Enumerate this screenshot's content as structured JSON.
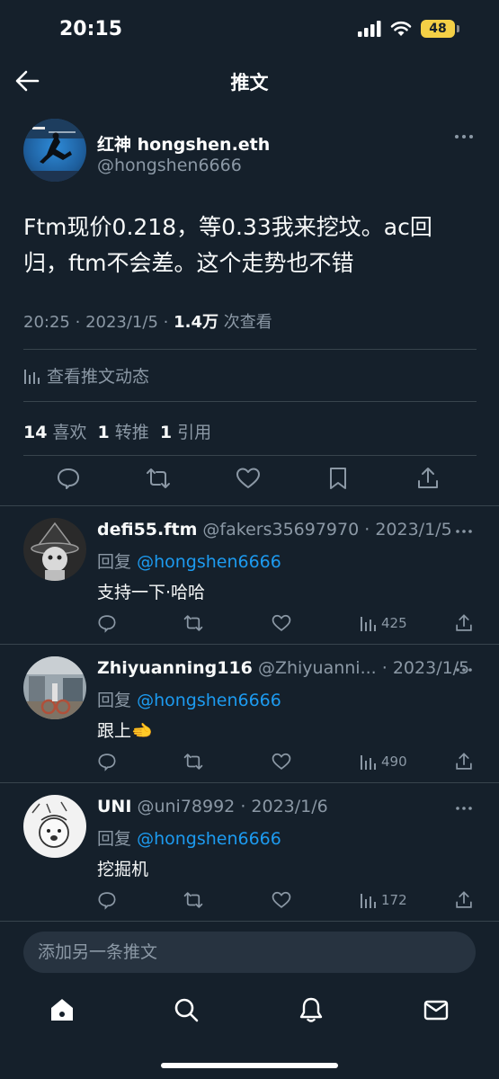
{
  "status_bar": {
    "time": "20:15",
    "battery": "48",
    "icons": [
      "cellular-signal-icon",
      "wifi-icon",
      "battery-icon"
    ]
  },
  "header": {
    "title": "推文",
    "back_icon": "arrow-left-icon"
  },
  "main_tweet": {
    "author_name": "红神 hongshen.eth",
    "author_handle": "@hongshen6666",
    "text": "Ftm现价0.218，等0.33我来挖坟。ac回归，ftm不会差。这个走势也不错",
    "time": "20:25",
    "date": "2023/1/5",
    "views_count": "1.4万",
    "views_label": "次查看",
    "analytics_label": "查看推文动态",
    "likes_count": "14",
    "likes_label": "喜欢",
    "retweets_count": "1",
    "retweets_label": "转推",
    "quotes_count": "1",
    "quotes_label": "引用",
    "actions": [
      "reply-icon",
      "retweet-icon",
      "like-icon",
      "bookmark-icon",
      "share-icon"
    ]
  },
  "replies": [
    {
      "name": "defi55.ftm",
      "handle": "@fakers35697970",
      "date": "2023/1/5",
      "reply_to_label": "回复",
      "reply_to": "@hongshen6666",
      "text": "支持一下·哈哈",
      "views": "425"
    },
    {
      "name": "Zhiyuanning116",
      "handle": "@Zhiyuanni...",
      "date": "2023/1/5",
      "reply_to_label": "回复",
      "reply_to": "@hongshen6666",
      "text": "跟上🫲",
      "views": "490"
    },
    {
      "name": "UNI",
      "handle": "@uni78992",
      "date": "2023/1/6",
      "reply_to_label": "回复",
      "reply_to": "@hongshen6666",
      "text": "挖掘机",
      "views": "172"
    }
  ],
  "compose": {
    "placeholder": "添加另一条推文"
  },
  "bottom_nav": {
    "items": [
      "home-icon",
      "search-icon",
      "notifications-bell-icon",
      "messages-envelope-icon"
    ],
    "active": "home-icon"
  },
  "colors": {
    "background": "#15202b",
    "accent": "#1d9bf0",
    "secondary_text": "#8b98a5",
    "divider": "#38444d",
    "battery": "#f4d046"
  }
}
